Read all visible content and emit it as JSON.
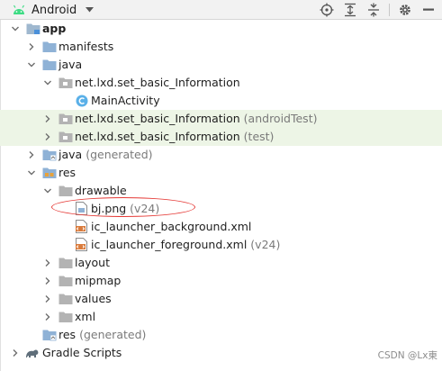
{
  "toolbar": {
    "title": "Android",
    "actions": [
      "crosshair-icon",
      "expand-all-icon",
      "collapse-all-icon",
      "gear-icon",
      "hide-icon"
    ]
  },
  "tree": {
    "app": "app",
    "manifests": "manifests",
    "java": "java",
    "pkg_main": "net.lxd.set_basic_Information",
    "main_activity": "MainActivity",
    "pkg_android_test": "net.lxd.set_basic_Information",
    "pkg_android_test_hint": "(androidTest)",
    "pkg_test": "net.lxd.set_basic_Information",
    "pkg_test_hint": "(test)",
    "java_generated": "java",
    "java_generated_hint": "(generated)",
    "res": "res",
    "drawable": "drawable",
    "bj_png": "bj.png",
    "bj_png_hint": "(v24)",
    "ic_bg": "ic_launcher_background.xml",
    "ic_fg": "ic_launcher_foreground.xml",
    "ic_fg_hint": "(v24)",
    "layout": "layout",
    "mipmap": "mipmap",
    "values": "values",
    "xml": "xml",
    "res_generated": "res",
    "res_generated_hint": "(generated)",
    "gradle_scripts": "Gradle Scripts"
  },
  "watermark": "CSDN @Lx東",
  "colors": {
    "highlight_row": "#edf5e6",
    "annotation_ring": "#e53935",
    "folder_blue": "#8fb2d6",
    "android_green": "#3ddc84"
  }
}
